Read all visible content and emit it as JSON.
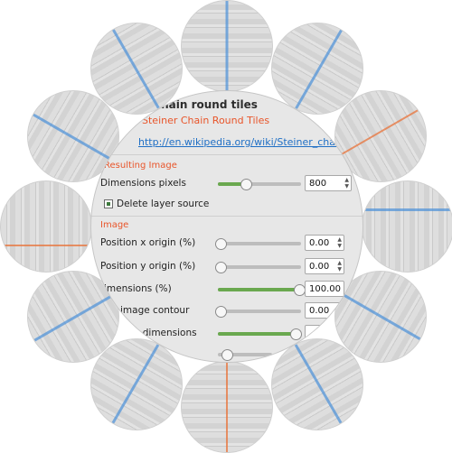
{
  "window": {
    "title": "chain round tiles",
    "subtitle": "Steiner Chain Round Tiles",
    "link": "http://en.wikipedia.org/wiki/Steiner_chain"
  },
  "sections": {
    "resulting_image": "Resulting Image",
    "image": "Image"
  },
  "controls": {
    "dimensions_pixels": {
      "label": "Dimensions pixels",
      "value": "800"
    },
    "delete_layer_source": {
      "label": "Delete layer source",
      "checked": true
    },
    "position_x": {
      "label": "Position x origin (%)",
      "value": "0.00"
    },
    "position_y": {
      "label": "Position y origin (%)",
      "value": "0.00"
    },
    "dimensions_pct": {
      "label": "imensions (%)",
      "value": "100.00"
    },
    "image_contour": {
      "label": "image contour",
      "value": "0.00"
    },
    "contour_dimensions": {
      "label": "our dimensions",
      "value": ""
    }
  },
  "colors": {
    "accent_orange": "#e8552a",
    "link_blue": "#1f6fc5",
    "slider_green": "#6aa84f"
  }
}
